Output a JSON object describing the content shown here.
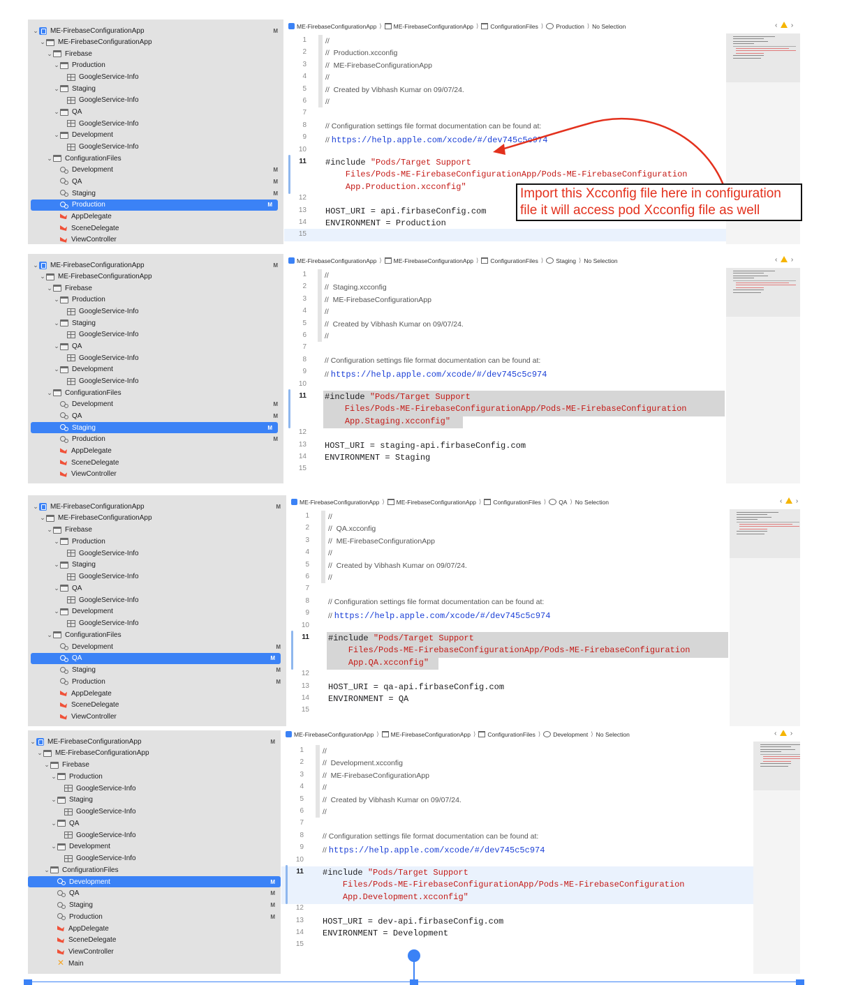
{
  "colors": {
    "accent": "#3b82f6",
    "sidebar_bg": "#e2e2e2",
    "string": "#c41a16",
    "url": "#1a3fd6",
    "annotation": "#e3311d"
  },
  "navigator": {
    "project_name": "ME-FirebaseConfigurationApp",
    "group_name": "ME-FirebaseConfigurationApp",
    "firebase": "Firebase",
    "production": "Production",
    "staging": "Staging",
    "qa": "QA",
    "development": "Development",
    "google_service": "GoogleService-Info",
    "config_files": "ConfigurationFiles",
    "app_delegate": "AppDelegate",
    "scene_delegate": "SceneDelegate",
    "view_controller": "ViewController",
    "main": "Main",
    "modified_flag": "M"
  },
  "panels": [
    {
      "breadcrumb": [
        "ME-FirebaseConfigurationApp",
        "ME-FirebaseConfigurationApp",
        "ConfigurationFiles",
        "Production",
        "No Selection"
      ],
      "selected": "Production",
      "file_comment": "//  Production.xcconfig",
      "include_last": "App.Production.xcconfig\"",
      "host": "HOST_URI = api.firbaseConfig.com",
      "env": "ENVIRONMENT = Production"
    },
    {
      "breadcrumb": [
        "ME-FirebaseConfigurationApp",
        "ME-FirebaseConfigurationApp",
        "ConfigurationFiles",
        "Staging",
        "No Selection"
      ],
      "selected": "Staging",
      "file_comment": "//  Staging.xcconfig",
      "include_last": "App.Staging.xcconfig\"",
      "host": "HOST_URI = staging-api.firbaseConfig.com",
      "env": "ENVIRONMENT = Staging"
    },
    {
      "breadcrumb": [
        "ME-FirebaseConfigurationApp",
        "ME-FirebaseConfigurationApp",
        "ConfigurationFiles",
        "QA",
        "No Selection"
      ],
      "selected": "QA",
      "file_comment": "//  QA.xcconfig",
      "include_last": "App.QA.xcconfig\"",
      "host": "HOST_URI = qa-api.firbaseConfig.com",
      "env": "ENVIRONMENT = QA"
    },
    {
      "breadcrumb": [
        "ME-FirebaseConfigurationApp",
        "ME-FirebaseConfigurationApp",
        "ConfigurationFiles",
        "Development",
        "No Selection"
      ],
      "selected": "Development",
      "file_comment": "//  Development.xcconfig",
      "include_last": "App.Development.xcconfig\"",
      "host": "HOST_URI = dev-api.firbaseConfig.com",
      "env": "ENVIRONMENT = Development"
    }
  ],
  "code": {
    "slashes": "//",
    "app_comment": "//  ME-FirebaseConfigurationApp",
    "created_comment": "//  Created by Vibhash Kumar on 09/07/24.",
    "doc_comment": "// Configuration settings file format documentation can be found at:",
    "url_prefix": "// ",
    "url": "https://help.apple.com/xcode/#/dev745c5c974",
    "include_keyword": "#include ",
    "include_part1": "\"Pods/Target Support",
    "include_part2": "    Files/Pods-ME-FirebaseConfigurationApp/Pods-ME-FirebaseConfiguration"
  },
  "line_numbers": [
    "1",
    "2",
    "3",
    "4",
    "5",
    "6",
    "7",
    "8",
    "9",
    "10",
    "11",
    "12",
    "13",
    "14",
    "15"
  ],
  "annotation": {
    "line1": "Import this Xcconfig file here in configuration",
    "line2": "file it will access pod Xcconfig file as well"
  }
}
